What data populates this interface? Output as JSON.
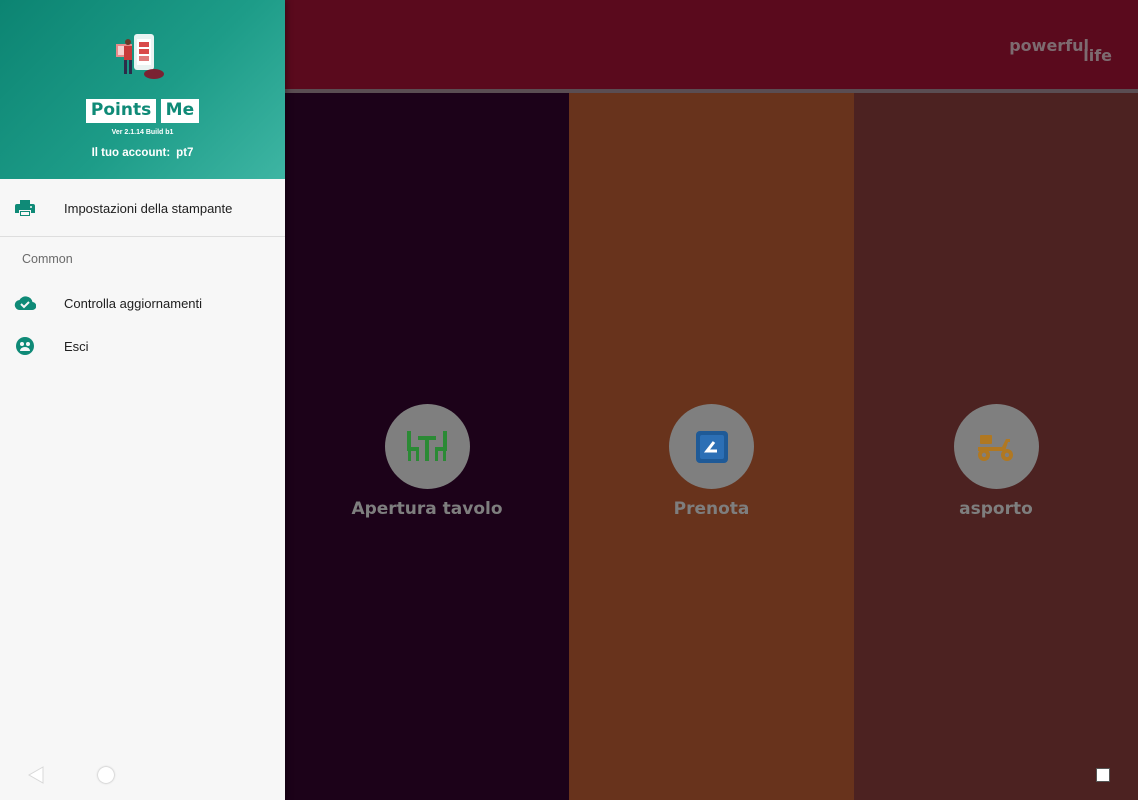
{
  "drawer": {
    "logo": {
      "word1": "Points",
      "word2": "Me"
    },
    "version": "Ver 2.1.14  Build b1",
    "account_label": "Il tuo account:",
    "account_value": "pt7",
    "items": [
      {
        "label": "Impostazioni della stampante",
        "icon": "printer-icon"
      }
    ],
    "section_title": "Common",
    "common_items": [
      {
        "label": "Controlla aggiornamenti",
        "icon": "cloud-check-icon"
      },
      {
        "label": "Esci",
        "icon": "logout-icon"
      }
    ]
  },
  "main": {
    "brand": {
      "line1": "powerful",
      "line2": "life"
    },
    "panels": [
      {
        "label": "Apertura tavolo",
        "icon": "table-chairs-icon",
        "color": "#1c0219"
      },
      {
        "label": "Prenota",
        "icon": "calendar-icon",
        "color": "#68331c"
      },
      {
        "label": "asporto",
        "icon": "scooter-icon",
        "color": "#4c2221"
      }
    ]
  },
  "colors": {
    "accent": "#0f8a77",
    "topbar": "#5a0a1d"
  }
}
